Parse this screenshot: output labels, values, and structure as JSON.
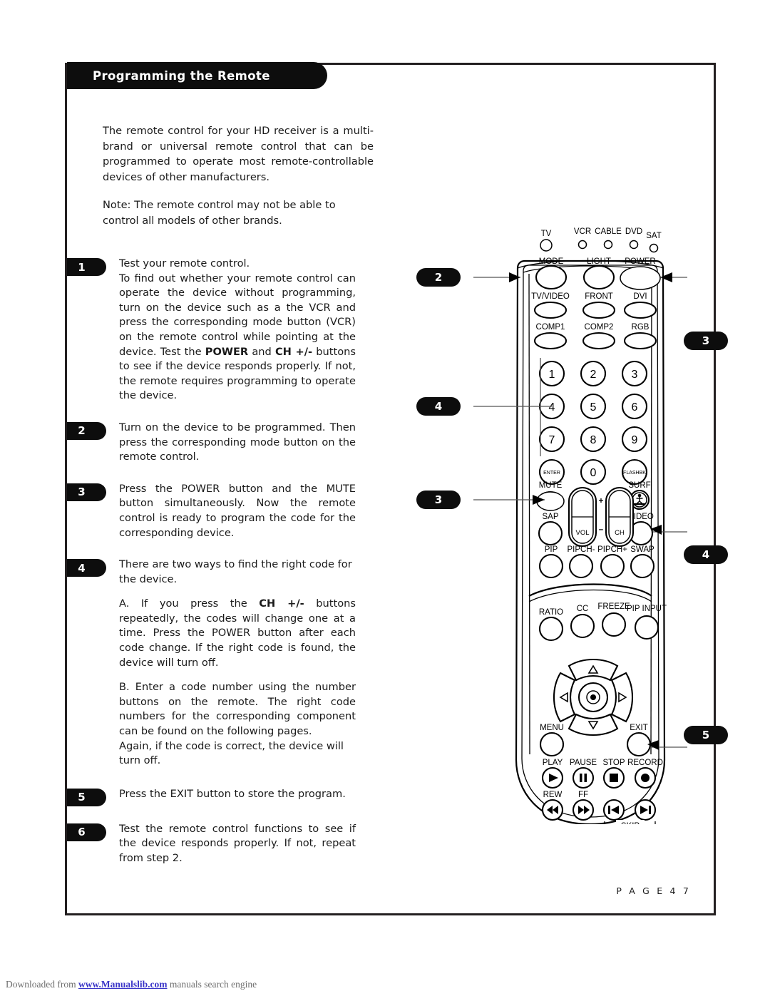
{
  "header": {
    "title": "Programming the Remote"
  },
  "intro": {
    "p1": "The remote control for your HD receiver is a multi-brand or universal remote control that can be programmed to operate most remote-controllable devices of other manufacturers.",
    "p2": "Note: The remote control may not be able to control all models of other brands."
  },
  "steps": [
    {
      "number": "1",
      "lines": [
        "Test your remote control.",
        "To find out whether your remote control can operate the device without programming, turn on the device such as a the VCR and press the corresponding mode button (VCR) on the remote control while pointing at the device. Test the POWER and CH +/- buttons to see if the device responds properly. If not, the remote requires programming to operate the device."
      ]
    },
    {
      "number": "2",
      "lines": [
        "Turn on the device to be programmed. Then press the corresponding mode button on the remote control."
      ]
    },
    {
      "number": "3",
      "lines": [
        "Press the POWER button and the MUTE button simultaneously. Now the remote control is ready to program the code for the corresponding device."
      ]
    },
    {
      "number": "4",
      "lines": [
        "There are two ways to find the right code for the device.",
        "A. If  you press the CH +/- buttons repeatedly, the codes will change one at a time. Press the POWER button after each code change. If the right code is found, the device will turn off.",
        "B. Enter a code number using the number buttons on the remote. The right code numbers for the corresponding component can be found on the following pages.",
        "Again, if the code is correct, the device will turn off."
      ]
    },
    {
      "number": "5",
      "lines": [
        "Press the EXIT button to store the program."
      ]
    },
    {
      "number": "6",
      "lines": [
        "Test the remote control functions to see if the device responds properly. If not, repeat from step 2."
      ]
    }
  ],
  "footer": {
    "page_label": "P A G E   4 7"
  },
  "watermark": {
    "prefix": "Downloaded from ",
    "link": "www.Manualslib.com",
    "suffix": " manuals search engine"
  },
  "remote": {
    "mode_leds": [
      "TV",
      "VCR",
      "CABLE",
      "DVD",
      "SAT"
    ],
    "row_mode": [
      "MODE",
      "LIGHT",
      "POWER"
    ],
    "row_input1": [
      "TV/VIDEO",
      "FRONT",
      "DVI"
    ],
    "row_input2": [
      "COMP1",
      "COMP2",
      "RGB"
    ],
    "keypad": [
      "1",
      "2",
      "3",
      "4",
      "5",
      "6",
      "7",
      "8",
      "9",
      "ENTER",
      "0",
      "FLASHBK"
    ],
    "mute": "MUTE",
    "surf": "SURF",
    "sap": "SAP",
    "video": "VIDEO",
    "vol": "VOL",
    "ch": "CH",
    "plus": "+",
    "minus": "—",
    "pip_row": [
      "PIP",
      "PIPCH-",
      "PIPCH+",
      "SWAP"
    ],
    "feature_row": [
      "RATIO",
      "CC",
      "FREEZE",
      "PIP INPUT"
    ],
    "menu": "MENU",
    "exit": "EXIT",
    "transport_row1": [
      "PLAY",
      "PAUSE",
      "STOP",
      "RECORD"
    ],
    "transport_row2": [
      "REW",
      "FF"
    ],
    "skip": "SKIP"
  },
  "callouts": {
    "left": [
      "2",
      "4",
      "3"
    ],
    "right": [
      "3",
      "4",
      "5"
    ]
  },
  "colors": {
    "ink": "#231f20",
    "badge": "#0d0d0d",
    "link": "#3a35c8"
  }
}
